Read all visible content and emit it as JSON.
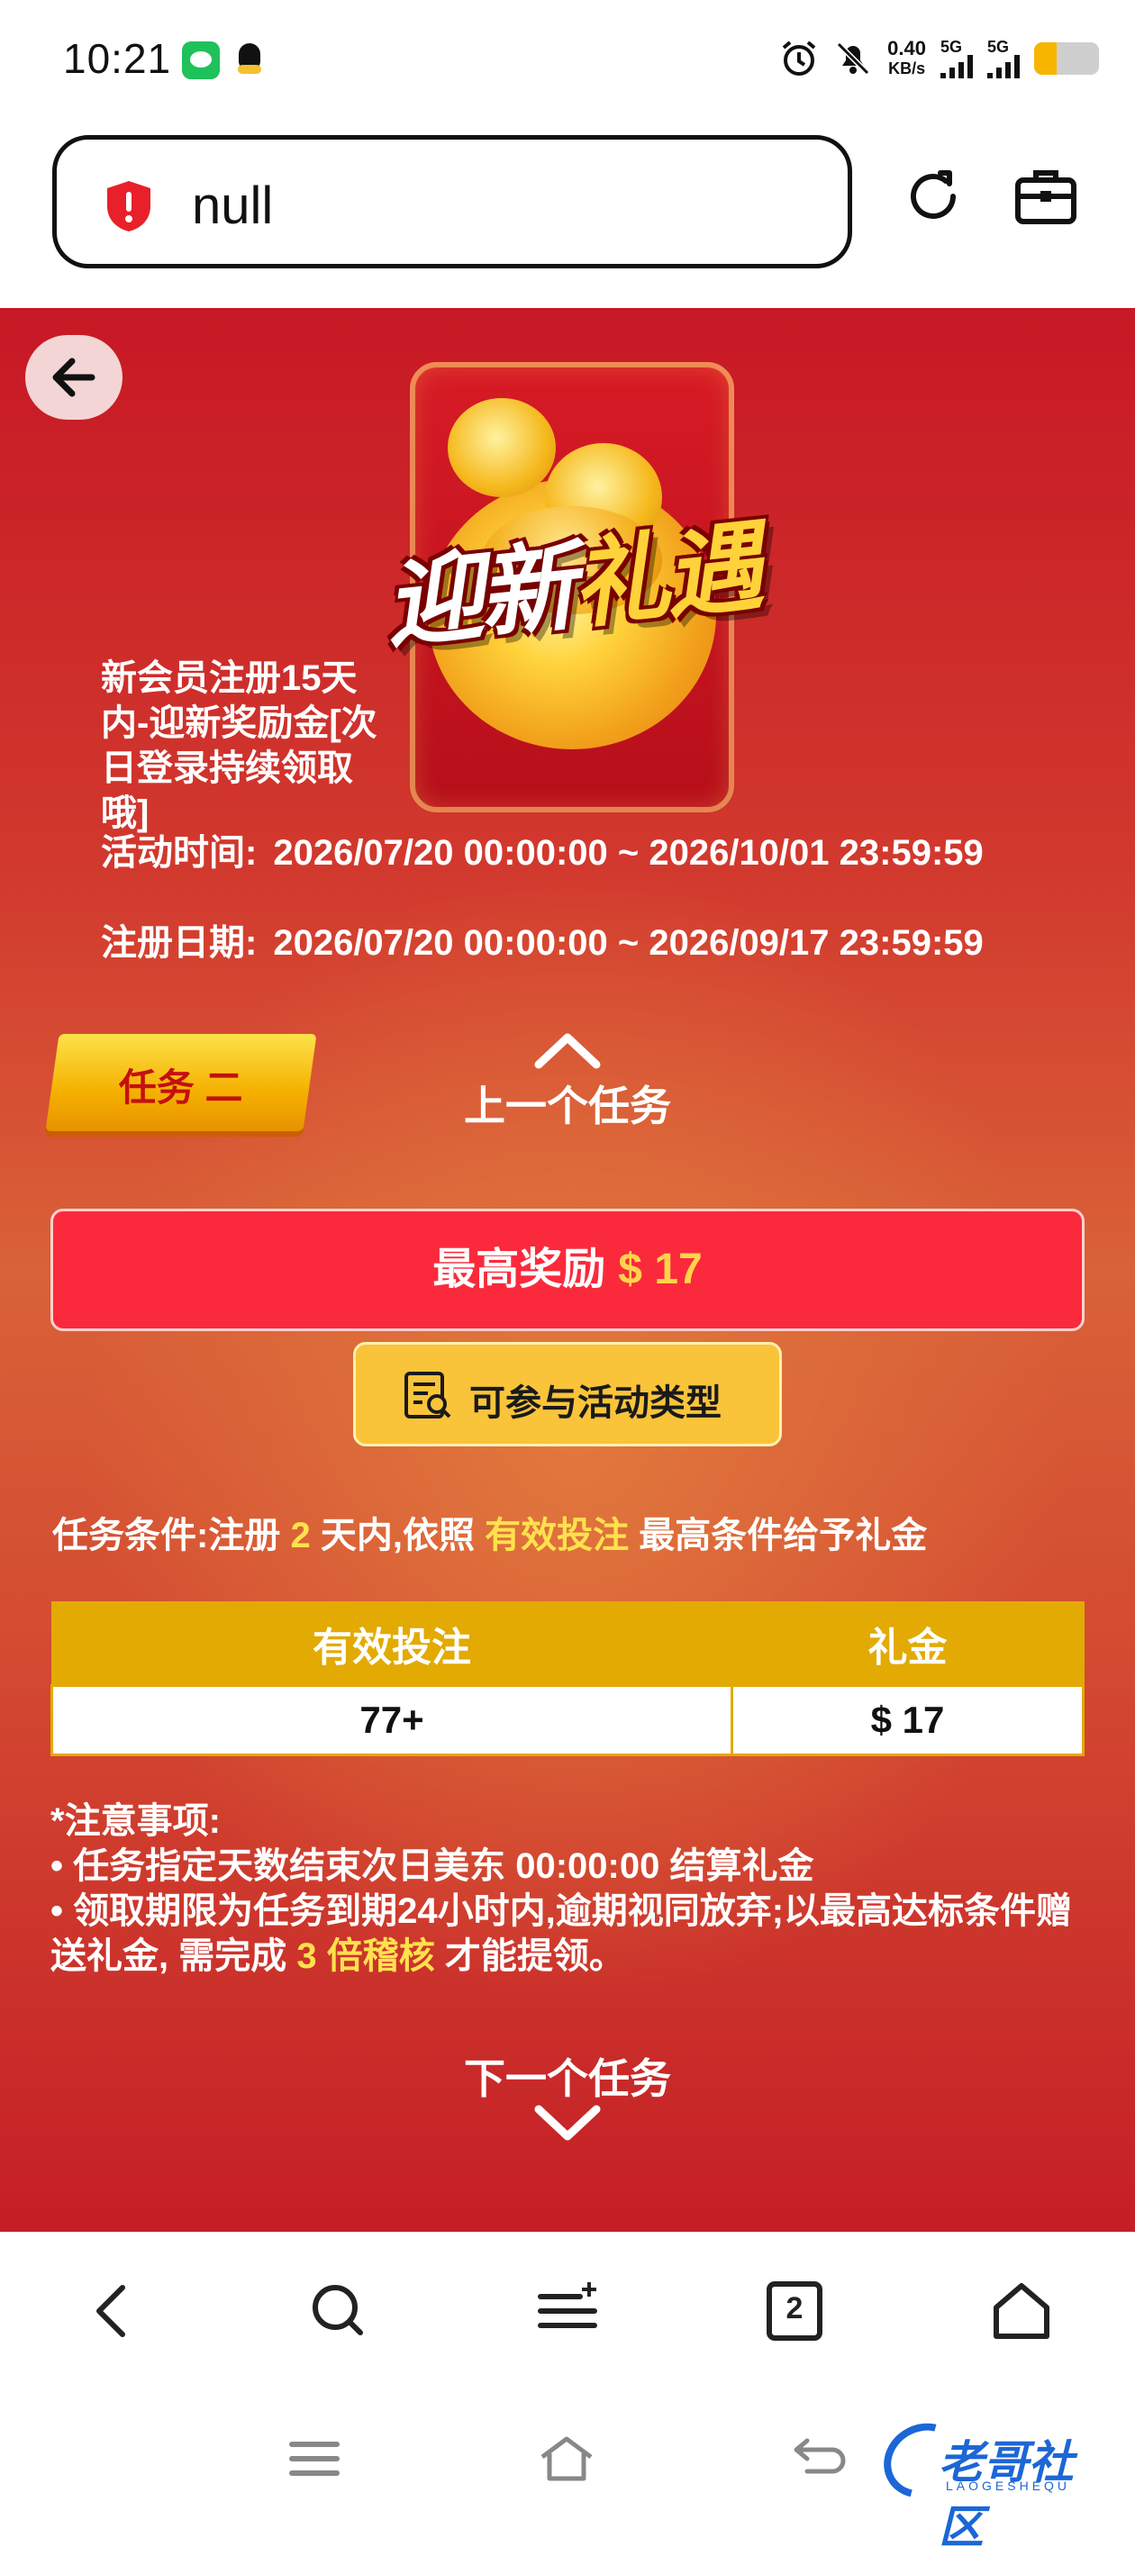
{
  "status_bar": {
    "time": "10:21",
    "net_speed_value": "0.40",
    "net_speed_unit": "KB/s",
    "sim1_label": "5G",
    "sim2_label": "5G",
    "battery_level": 0.35,
    "icons": [
      "wechat-icon",
      "qq-icon",
      "alarm-icon",
      "mute-icon",
      "signal-icon",
      "battery-icon"
    ]
  },
  "address_bar": {
    "url": "null",
    "security_icon": "shield-alert-icon",
    "reload_icon": "reload-icon",
    "toolbox_icon": "toolbox-icon"
  },
  "promo": {
    "hero_title_part1": "迎新",
    "hero_title_part2": "礼遇",
    "description": "新会员注册15天内-迎新奖励金[次日登录持续领取哦]",
    "activity_time_label": "活动时间:",
    "activity_time_value": "2026/07/20 00:00:00 ~ 2026/10/01 23:59:59",
    "register_date_label": "注册日期:",
    "register_date_value": "2026/07/20 00:00:00 ~ 2026/09/17 23:59:59",
    "task_tag": "任务 二",
    "prev_task": "上一个任务",
    "reward_label": "最高奖励",
    "reward_amount": "$ 17",
    "activity_types_button": "可参与活动类型",
    "condition_prefix": "任务条件:注册",
    "condition_days": "2",
    "condition_mid": "天内,依照",
    "condition_highlight": "有效投注",
    "condition_suffix": "最高条件给予礼金",
    "table": {
      "headers": [
        "有效投注",
        "礼金"
      ],
      "rows": [
        [
          "77+",
          "$ 17"
        ]
      ]
    },
    "notes_title": "*注意事项:",
    "note1": "• 任务指定天数结束次日美东 00:00:00 结算礼金",
    "note2_part1": "• 领取期限为任务到期24小时内,逾期视同放弃;以最高达标条件赠送礼金, 需完成",
    "note2_highlight": "3 倍稽核",
    "note2_part2": "才能提领。",
    "next_task": "下一个任务"
  },
  "browser_nav": {
    "tab_count": "2",
    "buttons": [
      "back-icon",
      "search-icon",
      "menu-icon",
      "tabs-icon",
      "home-icon"
    ]
  },
  "watermark": {
    "text": "老哥社区",
    "subtext": "LAOGESHEQU"
  },
  "colors": {
    "accent_red": "#fa2a3c",
    "gold": "#e2aa02",
    "highlight_yellow": "#ffe14d"
  }
}
